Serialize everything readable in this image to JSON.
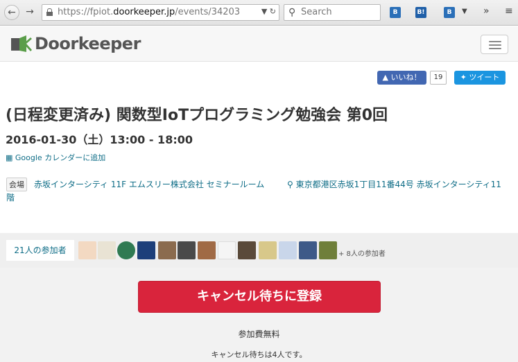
{
  "browser": {
    "url_prefix": "https://fpiot.",
    "url_domain": "doorkeeper.jp",
    "url_path": "/events/34203",
    "search_placeholder": "Search",
    "back_icon": "back-arrow-icon",
    "forward_icon": "forward-arrow-icon"
  },
  "site": {
    "logo_text": "Doorkeeper"
  },
  "social": {
    "like_label": "いいね！",
    "like_count": "19",
    "tweet_label": "ツイート"
  },
  "event": {
    "title": "(日程変更済み) 関数型IoTプログラミング勉強会 第0回",
    "datetime": "2016-01-30（土）13:00 - 18:00",
    "gcal_label": "Google カレンダーに追加",
    "venue_label": "会場",
    "venue_name": "赤坂インターシティ 11F エムスリー株式会社 セミナールーム",
    "venue_address_line1": "東京都港区赤坂1丁目11番44号 赤坂インターシティ11",
    "venue_address_line2": "階"
  },
  "participants": {
    "count_label": "21人の参加者",
    "more_label": "+ 8人の参加者"
  },
  "cta": {
    "label": "キャンセル待ちに登録"
  },
  "fee": "参加費無料",
  "waitlist": "キャンセル待ちは4人です。",
  "colors": {
    "brand": "#5b9e4a",
    "link": "#0d6c86",
    "cta": "#d9243c"
  }
}
